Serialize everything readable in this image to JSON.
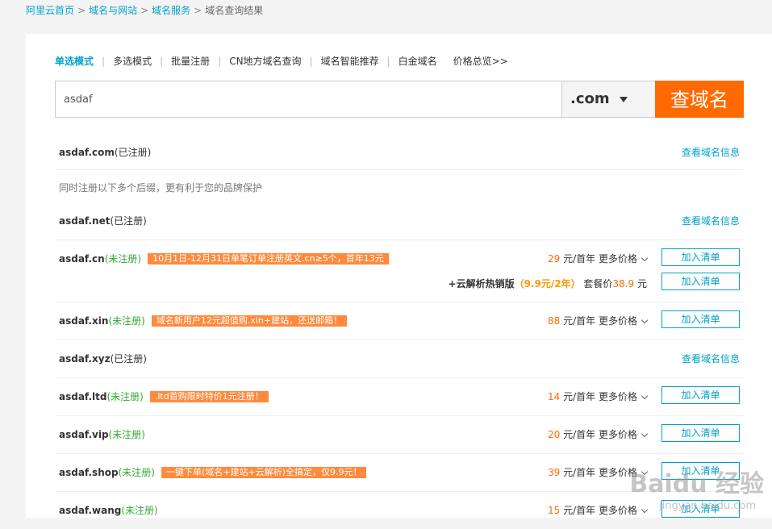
{
  "breadcrumb": {
    "items": [
      "阿里云首页",
      "域名与网站",
      "域名服务"
    ],
    "current": "域名查询结果",
    "separator": ">"
  },
  "mode_tabs": {
    "items": [
      "单选模式",
      "多选模式",
      "批量注册",
      "CN地方域名查询",
      "域名智能推荐",
      "白金域名"
    ],
    "price_overview": "价格总览>>"
  },
  "search": {
    "value": "asdaf",
    "suffix": ".com",
    "button_label": "查域名"
  },
  "common": {
    "view_info": "查看域名信息",
    "add_to_list": "加入清单",
    "price_unit": "元/首年",
    "more_price": "更多价格"
  },
  "hint": "同时注册以下多个后缀，更有利于您的品牌保护",
  "results": [
    {
      "domain": "asdaf.com",
      "status": "(已注册)",
      "registered": true
    },
    {
      "domain": "asdaf.net",
      "status": "(已注册)",
      "registered": true
    },
    {
      "domain": "asdaf.cn",
      "status": "(未注册)",
      "registered": false,
      "promo": "10月1日-12月31日单笔订单注册英文.cn≥5个，首年13元",
      "price": "29"
    },
    {
      "domain": "asdaf.xin",
      "status": "(未注册)",
      "registered": false,
      "promo": "域名新用户12元超值购.xin+建站，还送邮箱！",
      "price": "88"
    },
    {
      "domain": "asdaf.xyz",
      "status": "(已注册)",
      "registered": true
    },
    {
      "domain": "asdaf.ltd",
      "status": "(未注册)",
      "registered": false,
      "promo": ".ltd首购限时特价1元注册！",
      "price": "14"
    },
    {
      "domain": "asdaf.vip",
      "status": "(未注册)",
      "registered": false,
      "price": "20"
    },
    {
      "domain": "asdaf.shop",
      "status": "(未注册)",
      "registered": false,
      "promo": "一键下单(域名+建站+云解析)全搞定，仅9.9元！",
      "price": "39"
    },
    {
      "domain": "asdaf.wang",
      "status": "(未注册)",
      "registered": false,
      "price": "15"
    }
  ],
  "bundle": {
    "title": "+云解析热销版",
    "price_text": "（9.9元/2年）",
    "package_label": "套餐价",
    "package_price": "38.9",
    "unit": "元"
  },
  "watermark": {
    "text": "Baidu 经验",
    "url": "jingyan.baidu.com"
  },
  "colors": {
    "link": "#00a2ca",
    "orange": "#ff6a00",
    "promo_bg": "#ff8a3d",
    "unregistered": "#33aa33"
  }
}
